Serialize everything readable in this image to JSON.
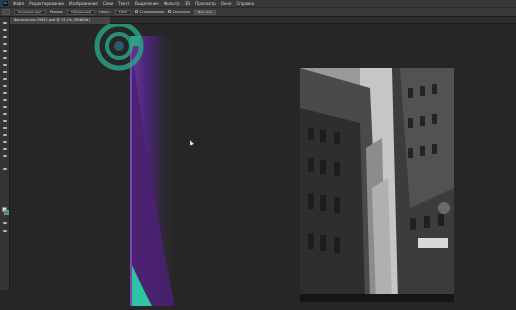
{
  "app": {
    "logo": "Ps",
    "menu": [
      "Файл",
      "Редактирование",
      "Изображение",
      "Слои",
      "Текст",
      "Выделение",
      "Фильтр",
      "3D",
      "Просмотр",
      "Окно",
      "Справка"
    ]
  },
  "options_bar": {
    "mode_label": "Основной цвет",
    "style_label": "Режим:",
    "style_value": "Нормальный",
    "opacity_label": "Непр.:",
    "opacity_value": "100%",
    "check1_label": "Сглаживание",
    "check2_label": "Смежные",
    "button_label": "Все слои"
  },
  "document_tab": {
    "title": "Фотосессия 29621.psd @ 15,2% (RGB/8#)"
  },
  "colors": {
    "accent_teal": "#2aa084",
    "accent_purple": "#5a2f86"
  }
}
